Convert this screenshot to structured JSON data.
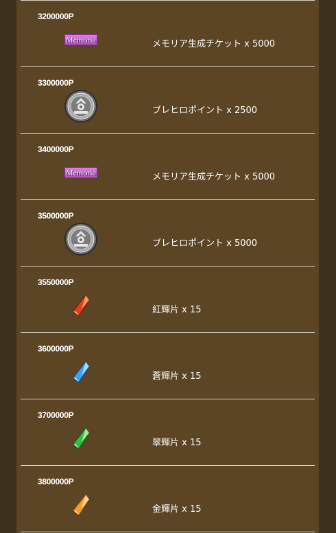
{
  "rewards": [
    {
      "points": "3200000P",
      "icon": "memoria-ticket-icon",
      "icon_text": "Memoria",
      "label": "メモリア生成チケット x 5000"
    },
    {
      "points": "3300000P",
      "icon": "brave-hero-coin-icon",
      "label": "ブレヒロポイント x 2500"
    },
    {
      "points": "3400000P",
      "icon": "memoria-ticket-icon",
      "icon_text": "Memoria",
      "label": "メモリア生成チケット x 5000"
    },
    {
      "points": "3500000P",
      "icon": "brave-hero-coin-icon",
      "label": "ブレヒロポイント x 5000"
    },
    {
      "points": "3550000P",
      "icon": "red-crystal-icon",
      "label": "紅輝片 x 15"
    },
    {
      "points": "3600000P",
      "icon": "blue-crystal-icon",
      "label": "蒼輝片 x 15"
    },
    {
      "points": "3700000P",
      "icon": "green-crystal-icon",
      "label": "翠輝片 x 15"
    },
    {
      "points": "3800000P",
      "icon": "gold-crystal-icon",
      "label": "金輝片 x 15"
    }
  ],
  "colors": {
    "background": "#3d301b",
    "panel": "#5c4524",
    "divider": "#d8d2c6",
    "red_crystal": "#e0401a",
    "blue_crystal": "#3aa2f0",
    "green_crystal": "#2fbf3a",
    "gold_crystal": "#f0a030"
  }
}
